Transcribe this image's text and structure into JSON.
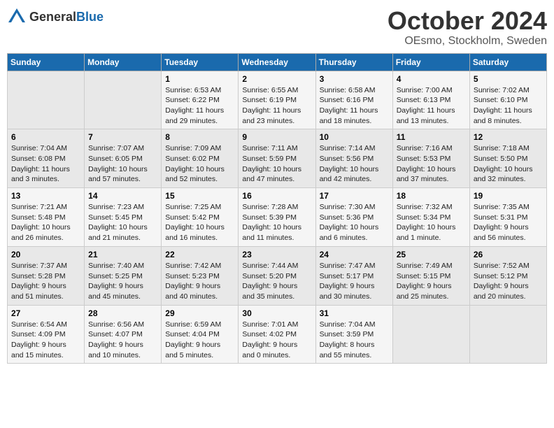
{
  "header": {
    "logo": {
      "general": "General",
      "blue": "Blue"
    },
    "month": "October 2024",
    "location": "OEsmo, Stockholm, Sweden"
  },
  "weekdays": [
    "Sunday",
    "Monday",
    "Tuesday",
    "Wednesday",
    "Thursday",
    "Friday",
    "Saturday"
  ],
  "weeks": [
    [
      {
        "day": "",
        "sunrise": "",
        "sunset": "",
        "daylight": ""
      },
      {
        "day": "",
        "sunrise": "",
        "sunset": "",
        "daylight": ""
      },
      {
        "day": "1",
        "sunrise": "Sunrise: 6:53 AM",
        "sunset": "Sunset: 6:22 PM",
        "daylight": "Daylight: 11 hours and 29 minutes."
      },
      {
        "day": "2",
        "sunrise": "Sunrise: 6:55 AM",
        "sunset": "Sunset: 6:19 PM",
        "daylight": "Daylight: 11 hours and 23 minutes."
      },
      {
        "day": "3",
        "sunrise": "Sunrise: 6:58 AM",
        "sunset": "Sunset: 6:16 PM",
        "daylight": "Daylight: 11 hours and 18 minutes."
      },
      {
        "day": "4",
        "sunrise": "Sunrise: 7:00 AM",
        "sunset": "Sunset: 6:13 PM",
        "daylight": "Daylight: 11 hours and 13 minutes."
      },
      {
        "day": "5",
        "sunrise": "Sunrise: 7:02 AM",
        "sunset": "Sunset: 6:10 PM",
        "daylight": "Daylight: 11 hours and 8 minutes."
      }
    ],
    [
      {
        "day": "6",
        "sunrise": "Sunrise: 7:04 AM",
        "sunset": "Sunset: 6:08 PM",
        "daylight": "Daylight: 11 hours and 3 minutes."
      },
      {
        "day": "7",
        "sunrise": "Sunrise: 7:07 AM",
        "sunset": "Sunset: 6:05 PM",
        "daylight": "Daylight: 10 hours and 57 minutes."
      },
      {
        "day": "8",
        "sunrise": "Sunrise: 7:09 AM",
        "sunset": "Sunset: 6:02 PM",
        "daylight": "Daylight: 10 hours and 52 minutes."
      },
      {
        "day": "9",
        "sunrise": "Sunrise: 7:11 AM",
        "sunset": "Sunset: 5:59 PM",
        "daylight": "Daylight: 10 hours and 47 minutes."
      },
      {
        "day": "10",
        "sunrise": "Sunrise: 7:14 AM",
        "sunset": "Sunset: 5:56 PM",
        "daylight": "Daylight: 10 hours and 42 minutes."
      },
      {
        "day": "11",
        "sunrise": "Sunrise: 7:16 AM",
        "sunset": "Sunset: 5:53 PM",
        "daylight": "Daylight: 10 hours and 37 minutes."
      },
      {
        "day": "12",
        "sunrise": "Sunrise: 7:18 AM",
        "sunset": "Sunset: 5:50 PM",
        "daylight": "Daylight: 10 hours and 32 minutes."
      }
    ],
    [
      {
        "day": "13",
        "sunrise": "Sunrise: 7:21 AM",
        "sunset": "Sunset: 5:48 PM",
        "daylight": "Daylight: 10 hours and 26 minutes."
      },
      {
        "day": "14",
        "sunrise": "Sunrise: 7:23 AM",
        "sunset": "Sunset: 5:45 PM",
        "daylight": "Daylight: 10 hours and 21 minutes."
      },
      {
        "day": "15",
        "sunrise": "Sunrise: 7:25 AM",
        "sunset": "Sunset: 5:42 PM",
        "daylight": "Daylight: 10 hours and 16 minutes."
      },
      {
        "day": "16",
        "sunrise": "Sunrise: 7:28 AM",
        "sunset": "Sunset: 5:39 PM",
        "daylight": "Daylight: 10 hours and 11 minutes."
      },
      {
        "day": "17",
        "sunrise": "Sunrise: 7:30 AM",
        "sunset": "Sunset: 5:36 PM",
        "daylight": "Daylight: 10 hours and 6 minutes."
      },
      {
        "day": "18",
        "sunrise": "Sunrise: 7:32 AM",
        "sunset": "Sunset: 5:34 PM",
        "daylight": "Daylight: 10 hours and 1 minute."
      },
      {
        "day": "19",
        "sunrise": "Sunrise: 7:35 AM",
        "sunset": "Sunset: 5:31 PM",
        "daylight": "Daylight: 9 hours and 56 minutes."
      }
    ],
    [
      {
        "day": "20",
        "sunrise": "Sunrise: 7:37 AM",
        "sunset": "Sunset: 5:28 PM",
        "daylight": "Daylight: 9 hours and 51 minutes."
      },
      {
        "day": "21",
        "sunrise": "Sunrise: 7:40 AM",
        "sunset": "Sunset: 5:25 PM",
        "daylight": "Daylight: 9 hours and 45 minutes."
      },
      {
        "day": "22",
        "sunrise": "Sunrise: 7:42 AM",
        "sunset": "Sunset: 5:23 PM",
        "daylight": "Daylight: 9 hours and 40 minutes."
      },
      {
        "day": "23",
        "sunrise": "Sunrise: 7:44 AM",
        "sunset": "Sunset: 5:20 PM",
        "daylight": "Daylight: 9 hours and 35 minutes."
      },
      {
        "day": "24",
        "sunrise": "Sunrise: 7:47 AM",
        "sunset": "Sunset: 5:17 PM",
        "daylight": "Daylight: 9 hours and 30 minutes."
      },
      {
        "day": "25",
        "sunrise": "Sunrise: 7:49 AM",
        "sunset": "Sunset: 5:15 PM",
        "daylight": "Daylight: 9 hours and 25 minutes."
      },
      {
        "day": "26",
        "sunrise": "Sunrise: 7:52 AM",
        "sunset": "Sunset: 5:12 PM",
        "daylight": "Daylight: 9 hours and 20 minutes."
      }
    ],
    [
      {
        "day": "27",
        "sunrise": "Sunrise: 6:54 AM",
        "sunset": "Sunset: 4:09 PM",
        "daylight": "Daylight: 9 hours and 15 minutes."
      },
      {
        "day": "28",
        "sunrise": "Sunrise: 6:56 AM",
        "sunset": "Sunset: 4:07 PM",
        "daylight": "Daylight: 9 hours and 10 minutes."
      },
      {
        "day": "29",
        "sunrise": "Sunrise: 6:59 AM",
        "sunset": "Sunset: 4:04 PM",
        "daylight": "Daylight: 9 hours and 5 minutes."
      },
      {
        "day": "30",
        "sunrise": "Sunrise: 7:01 AM",
        "sunset": "Sunset: 4:02 PM",
        "daylight": "Daylight: 9 hours and 0 minutes."
      },
      {
        "day": "31",
        "sunrise": "Sunrise: 7:04 AM",
        "sunset": "Sunset: 3:59 PM",
        "daylight": "Daylight: 8 hours and 55 minutes."
      },
      {
        "day": "",
        "sunrise": "",
        "sunset": "",
        "daylight": ""
      },
      {
        "day": "",
        "sunrise": "",
        "sunset": "",
        "daylight": ""
      }
    ]
  ]
}
